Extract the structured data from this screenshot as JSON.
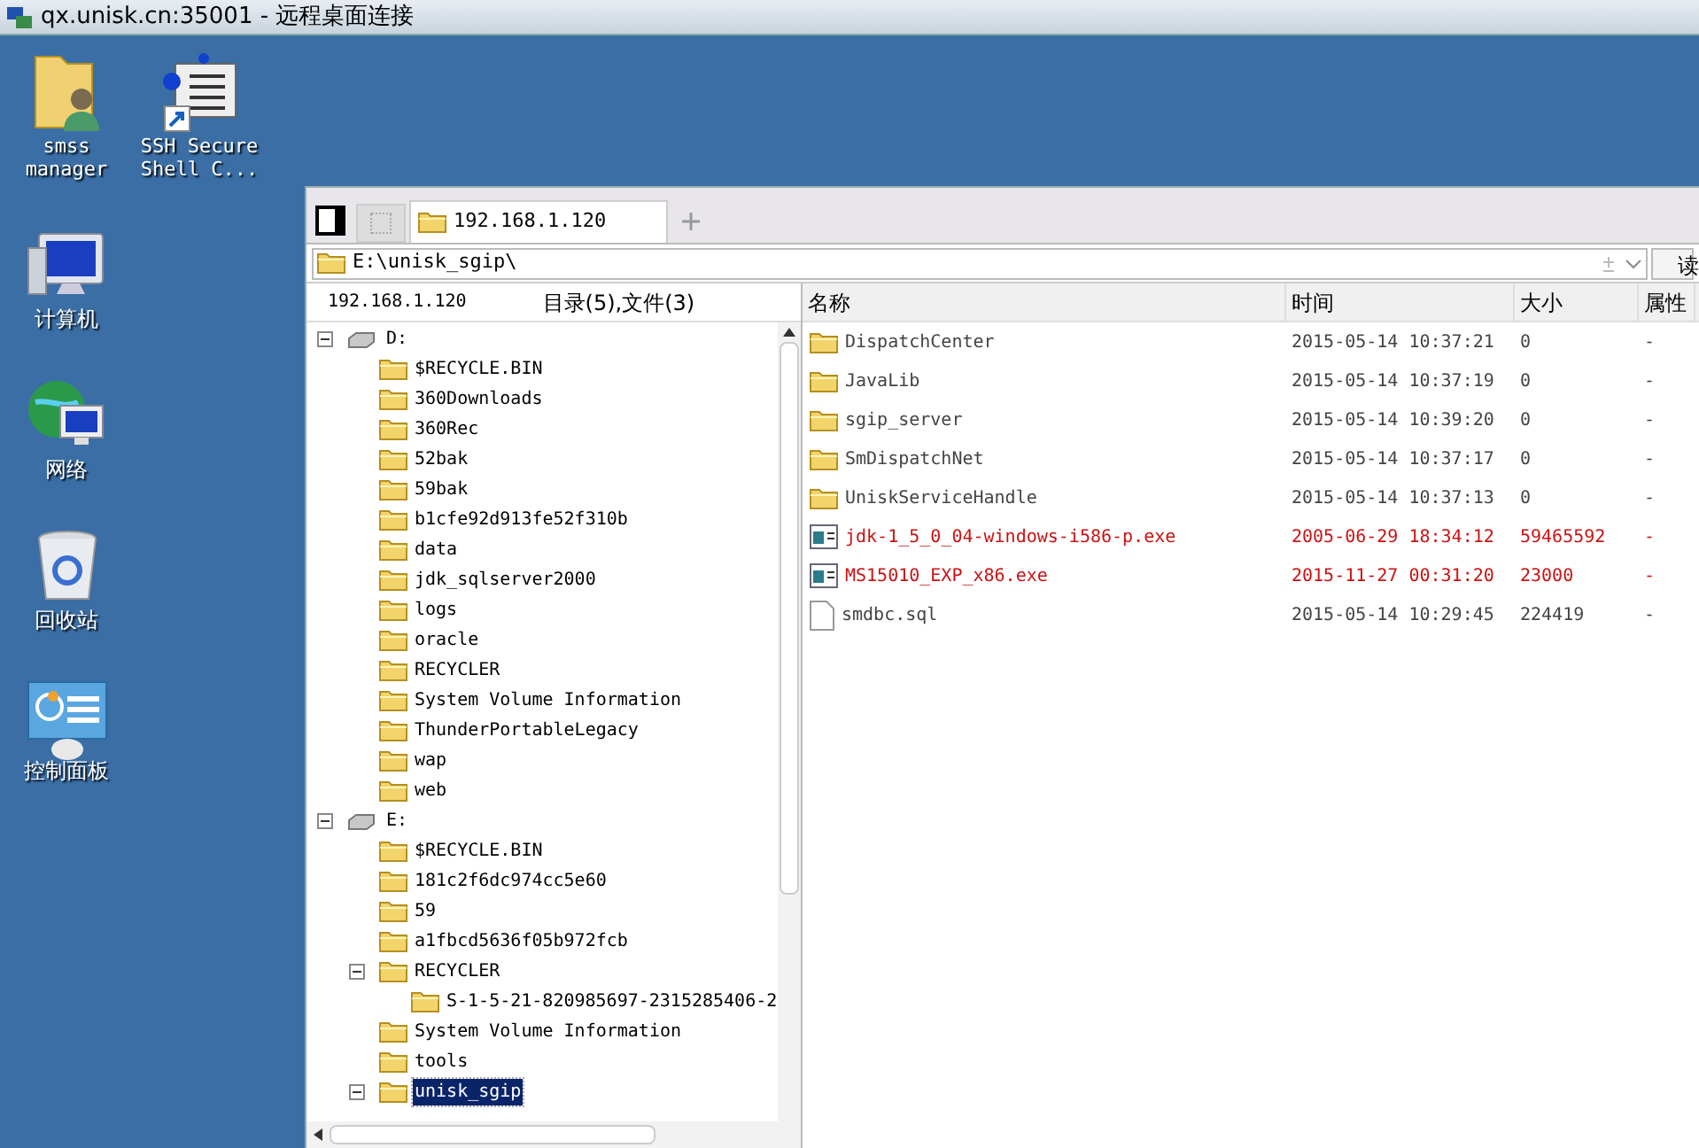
{
  "window": {
    "title": "qx.unisk.cn:35001 - 远程桌面连接"
  },
  "desktop_icons": [
    {
      "kind": "user-folder",
      "label": "smss\nmanager"
    },
    {
      "kind": "ssh",
      "label": "SSH Secure\nShell C..."
    },
    {
      "kind": "computer",
      "label": "计算机"
    },
    {
      "kind": "network",
      "label": "网络"
    },
    {
      "kind": "recycle",
      "label": "回收站"
    },
    {
      "kind": "control",
      "label": "控制面板"
    }
  ],
  "tabs": [
    {
      "label": "192.168.1.120",
      "selected": true
    }
  ],
  "path_bar": {
    "value": "E:\\unisk_sgip\\",
    "button": "读"
  },
  "tree_header": {
    "host": "192.168.1.120",
    "summary": "目录(5),文件(3)"
  },
  "tree": [
    {
      "kind": "drive",
      "label": "D:",
      "expanded": true,
      "selected": false,
      "children": [
        {
          "kind": "folder",
          "label": "$RECYCLE.BIN",
          "selected": false
        },
        {
          "kind": "folder",
          "label": "360Downloads",
          "selected": false
        },
        {
          "kind": "folder",
          "label": "360Rec",
          "selected": false
        },
        {
          "kind": "folder",
          "label": "52bak",
          "selected": false
        },
        {
          "kind": "folder",
          "label": "59bak",
          "selected": false
        },
        {
          "kind": "folder",
          "label": "b1cfe92d913fe52f310b",
          "selected": false
        },
        {
          "kind": "folder",
          "label": "data",
          "selected": false
        },
        {
          "kind": "folder",
          "label": "jdk_sqlserver2000",
          "selected": false
        },
        {
          "kind": "folder",
          "label": "logs",
          "selected": false
        },
        {
          "kind": "folder",
          "label": "oracle",
          "selected": false
        },
        {
          "kind": "folder",
          "label": "RECYCLER",
          "selected": false
        },
        {
          "kind": "folder",
          "label": "System Volume Information",
          "selected": false
        },
        {
          "kind": "folder",
          "label": "ThunderPortableLegacy",
          "selected": false
        },
        {
          "kind": "folder",
          "label": "wap",
          "selected": false
        },
        {
          "kind": "folder",
          "label": "web",
          "selected": false
        }
      ]
    },
    {
      "kind": "drive",
      "label": "E:",
      "expanded": true,
      "selected": false,
      "children": [
        {
          "kind": "folder",
          "label": "$RECYCLE.BIN",
          "selected": false
        },
        {
          "kind": "folder",
          "label": "181c2f6dc974cc5e60",
          "selected": false
        },
        {
          "kind": "folder",
          "label": "59",
          "selected": false
        },
        {
          "kind": "folder",
          "label": "a1fbcd5636f05b972fcb",
          "selected": false
        },
        {
          "kind": "folder",
          "label": "RECYCLER",
          "expanded": true,
          "selected": false,
          "children": [
            {
              "kind": "folder",
              "label": "S-1-5-21-820985697-2315285406-2",
              "selected": false
            }
          ]
        },
        {
          "kind": "folder",
          "label": "System Volume Information",
          "selected": false
        },
        {
          "kind": "folder",
          "label": "tools",
          "selected": false
        },
        {
          "kind": "folder",
          "label": "unisk_sgip",
          "expanded": true,
          "selected": true
        }
      ]
    }
  ],
  "file_list": {
    "columns": [
      "名称",
      "时间",
      "大小",
      "属性"
    ],
    "rows": [
      {
        "kind": "folder",
        "name": "DispatchCenter",
        "time": "2015-05-14 10:37:21",
        "size": "0",
        "attr": "-",
        "highlighted": false
      },
      {
        "kind": "folder",
        "name": "JavaLib",
        "time": "2015-05-14 10:37:19",
        "size": "0",
        "attr": "-",
        "highlighted": false
      },
      {
        "kind": "folder",
        "name": "sgip_server",
        "time": "2015-05-14 10:39:20",
        "size": "0",
        "attr": "-",
        "highlighted": false
      },
      {
        "kind": "folder",
        "name": "SmDispatchNet",
        "time": "2015-05-14 10:37:17",
        "size": "0",
        "attr": "-",
        "highlighted": false
      },
      {
        "kind": "folder",
        "name": "UniskServiceHandle",
        "time": "2015-05-14 10:37:13",
        "size": "0",
        "attr": "-",
        "highlighted": false
      },
      {
        "kind": "exe",
        "name": "jdk-1_5_0_04-windows-i586-p.exe",
        "time": "2005-06-29 18:34:12",
        "size": "59465592",
        "attr": "-",
        "highlighted": true
      },
      {
        "kind": "exe",
        "name": "MS15010_EXP_x86.exe",
        "time": "2015-11-27 00:31:20",
        "size": "23000",
        "attr": "-",
        "highlighted": true
      },
      {
        "kind": "file",
        "name": "smdbc.sql",
        "time": "2015-05-14 10:29:45",
        "size": "224419",
        "attr": "-",
        "highlighted": false
      }
    ]
  }
}
